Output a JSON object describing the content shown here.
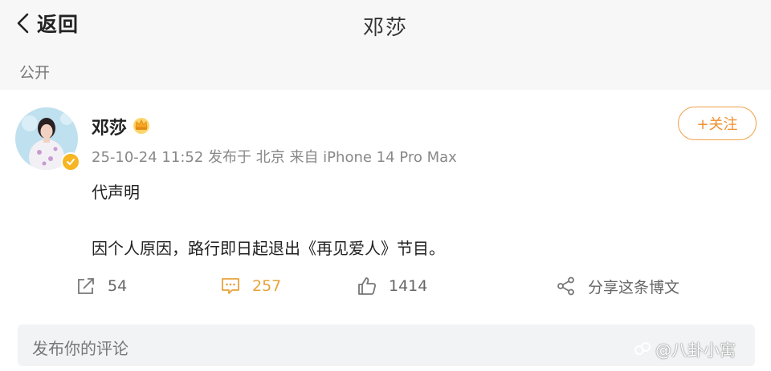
{
  "nav": {
    "back_label": "返回",
    "title": "邓莎"
  },
  "post": {
    "visibility": "公开",
    "author": "邓莎",
    "meta": "25-10-24 11:52  发布于 北京  来自 iPhone 14 Pro Max",
    "follow_label": "+关注",
    "text_line1": "代声明",
    "text_line2": "因个人原因，路行即日起退出《再见爱人》节目。"
  },
  "actions": {
    "repost_count": "54",
    "comment_count": "257",
    "like_count": "1414",
    "share_label": "分享这条博文"
  },
  "comment": {
    "placeholder": "发布你的评论"
  },
  "watermark": "@八卦小寓",
  "colors": {
    "accent": "#f09030",
    "comment_accent": "#e8a23a",
    "verify_badge": "#f6b521"
  }
}
